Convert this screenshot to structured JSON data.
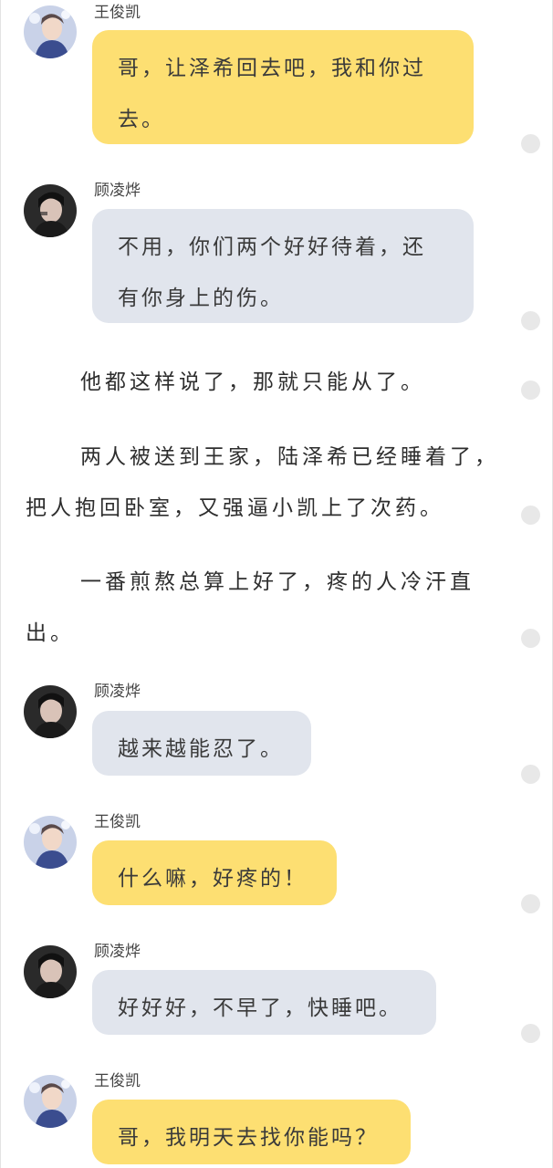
{
  "characters": {
    "wjk": {
      "name": "王俊凯"
    },
    "gll": {
      "name": "顾凌烨"
    }
  },
  "messages": [
    {
      "speaker": "王俊凯",
      "text": "哥，让泽希回去吧，我和你过去。"
    },
    {
      "speaker": "顾凌烨",
      "text": "不用，你们两个好好待着，还有你身上的伤。"
    },
    {
      "speaker": "顾凌烨",
      "text": "越来越能忍了。"
    },
    {
      "speaker": "王俊凯",
      "text": "什么嘛，好疼的！"
    },
    {
      "speaker": "顾凌烨",
      "text": "好好好，不早了，快睡吧。"
    },
    {
      "speaker": "王俊凯",
      "text": "哥，我明天去找你能吗？"
    }
  ],
  "narration": [
    "他都这样说了，那就只能从了。",
    "两人被送到王家，陆泽希已经睡着了，把人抱回卧室，又强逼小凯上了次药。",
    "一番煎熬总算上好了，疼的人冷汗直出。"
  ],
  "colors": {
    "wjk_bubble": "#fddf72",
    "gll_bubble": "#e1e5ed",
    "comment_dot": "#e8e8e8"
  },
  "icons": [
    "avatar-wangjunkai",
    "avatar-gulingye",
    "comment-dot"
  ]
}
